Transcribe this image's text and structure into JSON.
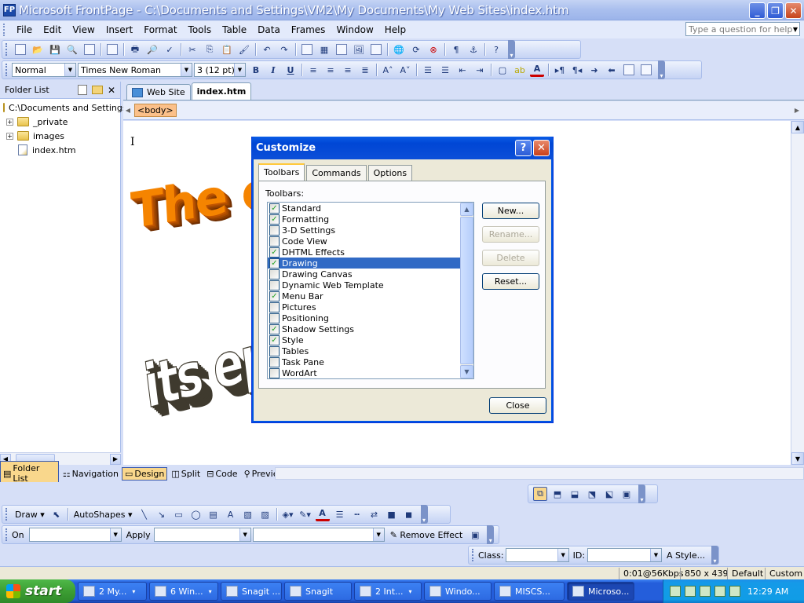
{
  "window": {
    "title": "Microsoft FrontPage - C:\\Documents and Settings\\VM2\\My Documents\\My Web Sites\\index.htm",
    "app_icon_label": "FP"
  },
  "menubar": {
    "items": [
      "File",
      "Edit",
      "View",
      "Insert",
      "Format",
      "Tools",
      "Table",
      "Data",
      "Frames",
      "Window",
      "Help"
    ],
    "ask_placeholder": "Type a question for help"
  },
  "formatting": {
    "style": "Normal",
    "font": "Times New Roman",
    "size": "3  (12 pt)",
    "bold": "B",
    "italic": "I",
    "underline": "U"
  },
  "folder_panel": {
    "title": "Folder List",
    "root": "C:\\Documents and Settings",
    "items": [
      {
        "label": "_private",
        "type": "folder"
      },
      {
        "label": "images",
        "type": "folder"
      },
      {
        "label": "index.htm",
        "type": "file"
      }
    ],
    "tabs": [
      "Folder List",
      "Navigation"
    ]
  },
  "doc_tabs": [
    "Web Site",
    "index.htm"
  ],
  "tag_selector": "<body>",
  "editor": {
    "wordart_top": "The epic",
    "wordart_bottom": "its epi"
  },
  "view_tabs": [
    "Design",
    "Split",
    "Code",
    "Preview"
  ],
  "dialog": {
    "title": "Customize",
    "tabs": [
      "Toolbars",
      "Commands",
      "Options"
    ],
    "list_label": "Toolbars:",
    "toolbars": [
      {
        "name": "Standard",
        "checked": true
      },
      {
        "name": "Formatting",
        "checked": true
      },
      {
        "name": "3-D Settings",
        "checked": false
      },
      {
        "name": "Code View",
        "checked": false
      },
      {
        "name": "DHTML Effects",
        "checked": true
      },
      {
        "name": "Drawing",
        "checked": true,
        "selected": true
      },
      {
        "name": "Drawing Canvas",
        "checked": false
      },
      {
        "name": "Dynamic Web Template",
        "checked": false
      },
      {
        "name": "Menu Bar",
        "checked": true
      },
      {
        "name": "Pictures",
        "checked": false
      },
      {
        "name": "Positioning",
        "checked": false
      },
      {
        "name": "Shadow Settings",
        "checked": true
      },
      {
        "name": "Style",
        "checked": true
      },
      {
        "name": "Tables",
        "checked": false
      },
      {
        "name": "Task Pane",
        "checked": false
      },
      {
        "name": "WordArt",
        "checked": false
      }
    ],
    "buttons": {
      "new": "New...",
      "rename": "Rename...",
      "delete": "Delete",
      "reset": "Reset...",
      "close": "Close"
    }
  },
  "drawing_toolbar": {
    "draw": "Draw",
    "autoshapes": "AutoShapes"
  },
  "dhtml_toolbar": {
    "on": "On",
    "apply": "Apply",
    "remove_effect": "Remove Effect"
  },
  "style_toolbar": {
    "class": "Class:",
    "id": "ID:",
    "style": "Style..."
  },
  "statusbar": {
    "speed": "0:01@56Kbps",
    "dims": "850 x 439",
    "mode": "Default",
    "custom": "Custom"
  },
  "taskbar": {
    "start": "start",
    "buttons": [
      "2 My...",
      "6 Win...",
      "Snagit ...",
      "Snagit",
      "2 Int...",
      "Windo...",
      "MISCS...",
      "Microso..."
    ],
    "clock": "12:29 AM"
  }
}
